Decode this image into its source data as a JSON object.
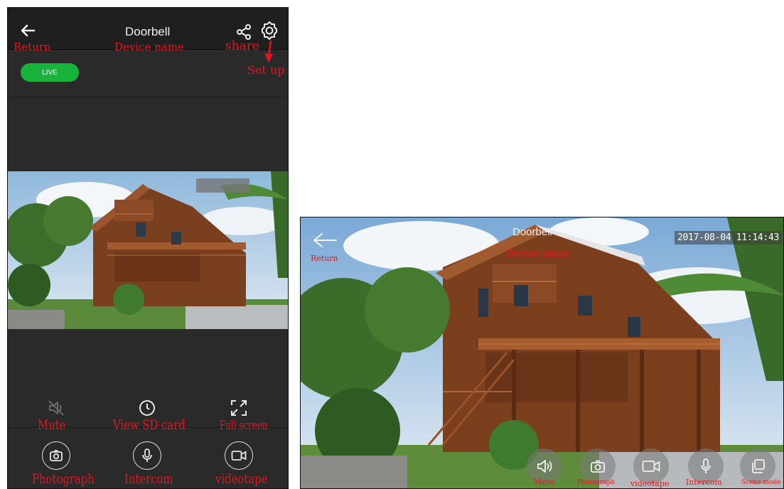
{
  "portrait": {
    "title": "Doorbell",
    "live_label": "LIVE",
    "annotations": {
      "return": "Return",
      "device_name": "Device name",
      "share": "share",
      "set_up": "Set up",
      "mute": "Mute",
      "view_sd": "View SD card",
      "full_screen": "Full screen",
      "photograph": "Photograph",
      "intercom": "Intercom",
      "videotape": "videotape"
    },
    "icons": [
      "back-arrow-icon",
      "share-icon",
      "settings-gear-icon",
      "mute-speaker-icon",
      "clock-icon",
      "fullscreen-icon",
      "camera-icon",
      "microphone-icon",
      "video-camera-icon"
    ]
  },
  "landscape": {
    "title": "Doorbell",
    "timestamp": "2017-08-04 11:14:43",
    "annotations": {
      "return": "Return",
      "device_name": "Device name",
      "mute": "Mute",
      "photograph": "Photograph",
      "videotape": "videotape",
      "intercom": "Intercom",
      "scene_mode": "Scene mode"
    },
    "icons": [
      "back-arrow-icon",
      "speaker-icon",
      "camera-icon",
      "video-camera-icon",
      "microphone-icon",
      "scene-mode-icon"
    ]
  },
  "colors": {
    "annotation": "#e8141c",
    "live": "#18b33a",
    "phone_bg": "#2a2a2a"
  }
}
